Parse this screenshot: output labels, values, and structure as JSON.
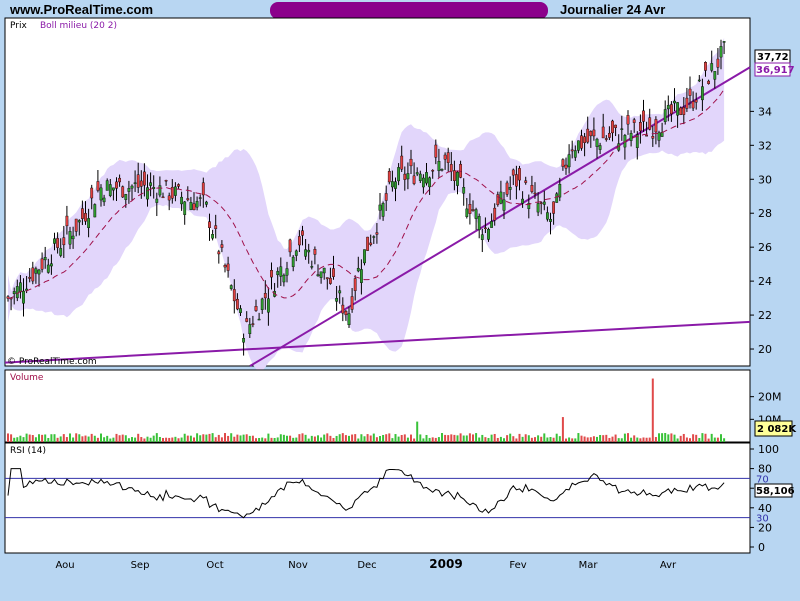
{
  "header": {
    "site": "www.ProRealTime.com",
    "period": "Journalier  24 Avr"
  },
  "price_panel": {
    "title": "Prix",
    "indicator": "Boll milieu (20 2)",
    "watermark": "© ProRealTime.com",
    "last_price_label": "37,72",
    "boll_mid_label": "36,917"
  },
  "volume_panel": {
    "title": "Volume",
    "last_label": "2 082K"
  },
  "rsi_panel": {
    "title": "RSI (14)",
    "last_label": "58,106",
    "upper_band_label": "70",
    "lower_band_label": "30"
  },
  "colors": {
    "background": "#b8d6f2",
    "panel_bg": "#ffffff",
    "band_fill": "#e2d6fb",
    "boll_mid": "#a0104a",
    "candle": "#000000",
    "up_body": "#2f9a2f",
    "down_body": "#e04040",
    "trendline": "#8a1aa8",
    "rsi_line": "#000000",
    "rsi_level": "#3333aa",
    "volume_up": "#39c239",
    "volume_down": "#e04a4a"
  },
  "chart_data": [
    {
      "type": "candlestick",
      "title": "Prix",
      "x_tick_labels": [
        "Aou",
        "Sep",
        "Oct",
        "Nov",
        "Dec",
        "2009",
        "Fev",
        "Mar",
        "Avr"
      ],
      "ylim": [
        19,
        39.5
      ],
      "y_ticks": [
        20,
        22,
        24,
        26,
        28,
        30,
        32,
        34
      ],
      "grid": false,
      "close_series_approx": {
        "Jul_mid": 23,
        "Aou_start": 27.5,
        "Aou_late": 29.5,
        "Sep_mid": 29.6,
        "Oct_start": 28.5,
        "Oct_late": 21.0,
        "Nov_start": 26.5,
        "Nov_mid": 24.0,
        "Nov_end": 22.0,
        "Dec_start": 25.0,
        "Dec_mid": 30.0,
        "2009_start": 31.0,
        "Jan_late": 27.0,
        "Fev_mid": 30.0,
        "Fev_late": 27.5,
        "Mar_start": 32.0,
        "Mar_late": 33.0,
        "Avr_start": 34.5,
        "Avr_late": 37.7
      },
      "last_price": 37.72,
      "boll_mid_last": 36.917
    },
    {
      "type": "bar",
      "title": "Volume",
      "y_ticks": [
        "10M",
        "20M"
      ],
      "last_value": "2 082K",
      "peak_note": "spike near late March (~28M)"
    },
    {
      "type": "line",
      "title": "RSI (14)",
      "ylim": [
        0,
        100
      ],
      "y_ticks": [
        0,
        20,
        40,
        60,
        80,
        100
      ],
      "levels": [
        30,
        70
      ],
      "last_value": 58.106
    }
  ]
}
